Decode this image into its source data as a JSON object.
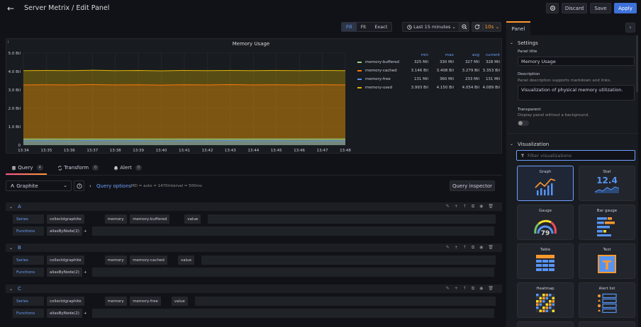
{
  "header": {
    "back": "←",
    "title": "Server Metrix / Edit Panel",
    "discard": "Discard",
    "save": "Save",
    "apply": "Apply"
  },
  "toolbar": {
    "fill": "Fill",
    "fit": "Fit",
    "exact": "Exact",
    "time_range": "Last 15 minutes",
    "refresh": "10s"
  },
  "chart_data": {
    "type": "area",
    "title": "Memory Usage",
    "y_ticks": [
      "0",
      "1.0 Bil",
      "2.0 Bil",
      "3.0 Bil",
      "4.0 Bil",
      "5.0 Bil"
    ],
    "ylim": [
      0,
      5
    ],
    "x": [
      "13:34",
      "13:35",
      "13:36",
      "13:37",
      "13:38",
      "13:39",
      "13:40",
      "13:41",
      "13:42",
      "13:43",
      "13:44",
      "13:45",
      "13:46",
      "13:47",
      "13:48"
    ],
    "series": [
      {
        "name": "memory-used",
        "color": "#e0b400",
        "values": [
          4.05,
          4.06,
          4.05,
          4.07,
          4.05,
          4.06,
          4.04,
          4.06,
          4.05,
          4.06,
          4.05,
          4.06,
          4.05,
          4.06,
          4.05
        ]
      },
      {
        "name": "memory-cached",
        "color": "#ff780a",
        "values": [
          3.27,
          3.28,
          3.27,
          3.29,
          3.27,
          3.28,
          3.26,
          3.28,
          3.27,
          3.29,
          3.27,
          3.28,
          3.27,
          3.28,
          3.27
        ]
      },
      {
        "name": "memory-buffered",
        "color": "#96d98d",
        "values": [
          0.33,
          0.33,
          0.33,
          0.33,
          0.33,
          0.33,
          0.33,
          0.33,
          0.33,
          0.33,
          0.33,
          0.33,
          0.33,
          0.33,
          0.33
        ]
      },
      {
        "name": "memory-free",
        "color": "#5794f2",
        "values": [
          0.23,
          0.24,
          0.22,
          0.25,
          0.23,
          0.24,
          0.22,
          0.24,
          0.23,
          0.25,
          0.23,
          0.24,
          0.22,
          0.24,
          0.23
        ]
      }
    ],
    "legend": {
      "headers": [
        "min",
        "max",
        "avg",
        "current"
      ],
      "rows": [
        {
          "name": "memory-buffered",
          "color": "#96d98d",
          "min": "325 Mil",
          "max": "330 Mil",
          "avg": "327 Mil",
          "current": "328 Mil"
        },
        {
          "name": "memory-cached",
          "color": "#ff780a",
          "min": "3.146 Bil",
          "max": "3.408 Bil",
          "avg": "3.279 Bil",
          "current": "3.353 Bil"
        },
        {
          "name": "memory-free",
          "color": "#5794f2",
          "min": "131 Mil",
          "max": "360 Mil",
          "avg": "233 Mil",
          "current": "131 Mil"
        },
        {
          "name": "memory-used",
          "color": "#e0b400",
          "min": "3.993 Bil",
          "max": "4.150 Bil",
          "avg": "4.054 Bil",
          "current": "4.089 Bil"
        }
      ]
    }
  },
  "tabs": [
    {
      "label": "Query",
      "count": "4"
    },
    {
      "label": "Transform",
      "count": "0"
    },
    {
      "label": "Alert",
      "count": "0"
    }
  ],
  "datasource": {
    "name": "Graphite",
    "query_options": "Query options",
    "meta": "MD = auto = 1470",
    "interval": "Interval = 500ms",
    "inspector": "Query inspector"
  },
  "queries": [
    {
      "id": "A",
      "series_label": "Series",
      "functions_label": "Functions",
      "series": [
        "collectdgraphite",
        "memory",
        "memory-buffered",
        "value"
      ],
      "function": "aliasByNode(2)"
    },
    {
      "id": "B",
      "series_label": "Series",
      "functions_label": "Functions",
      "series": [
        "collectdgraphite",
        "memory",
        "memory-cached",
        "value"
      ],
      "function": "aliasByNode(2)"
    },
    {
      "id": "C",
      "series_label": "Series",
      "functions_label": "Functions",
      "series": [
        "collectdgraphite",
        "memory",
        "memory-free",
        "value"
      ],
      "function": "aliasByNode(2)"
    }
  ],
  "right": {
    "tab": "Panel",
    "settings": "Settings",
    "panel_title_label": "Panel title",
    "panel_title": "Memory Usage",
    "description_label": "Description",
    "description_help": "Panel description supports markdown and links.",
    "description": "Visualization of physical memory utilization.",
    "transparent_label": "Transparent",
    "transparent_help": "Display panel without a background.",
    "visualization": "Visualization",
    "filter_placeholder": "Filter visualizations",
    "viz": [
      "Graph",
      "Stat",
      "Gauge",
      "Bar gauge",
      "Table",
      "Text",
      "Heatmap",
      "Alert list"
    ],
    "stat_value": "12.4",
    "gauge_value": "79",
    "text_glyph": "T"
  }
}
